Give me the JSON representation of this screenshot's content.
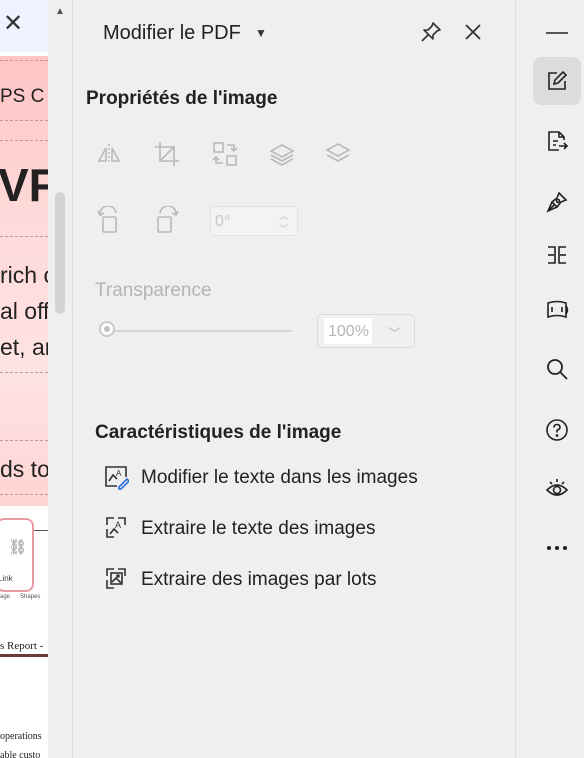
{
  "document": {
    "fragments": [
      "PS C",
      "VF",
      "rich c",
      "al off",
      "et, ar",
      "ds to",
      "Link",
      "age",
      "Shapes",
      "s Report -",
      "operations",
      "able custo"
    ]
  },
  "panel": {
    "title": "Modifier le PDF",
    "properties_title": "Propriétés de l'image",
    "rotation_value": "0°",
    "transparency_label": "Transparence",
    "transparency_value": "100%",
    "transparency_level": 0,
    "features_title": "Caractéristiques de l'image",
    "features": [
      {
        "label": "Modifier le texte dans les images",
        "icon": "edit-image-text-icon"
      },
      {
        "label": "Extraire le texte des images",
        "icon": "extract-text-icon"
      },
      {
        "label": "Extraire des images par lots",
        "icon": "batch-extract-images-icon"
      }
    ],
    "tools": [
      "flip-icon",
      "crop-icon",
      "replace-image-icon",
      "bring-forward-icon",
      "send-backward-icon",
      "rotate-left-icon",
      "rotate-right-icon"
    ]
  },
  "rail": {
    "items": [
      "edit-pdf-icon",
      "export-icon",
      "sign-icon",
      "compare-icon",
      "scan-icon",
      "search-icon",
      "help-icon",
      "view-icon",
      "more-icon"
    ]
  },
  "colors": {
    "active_rail": "#dcdcdf",
    "disabled": "#c0c0c4",
    "text": "#222222"
  }
}
